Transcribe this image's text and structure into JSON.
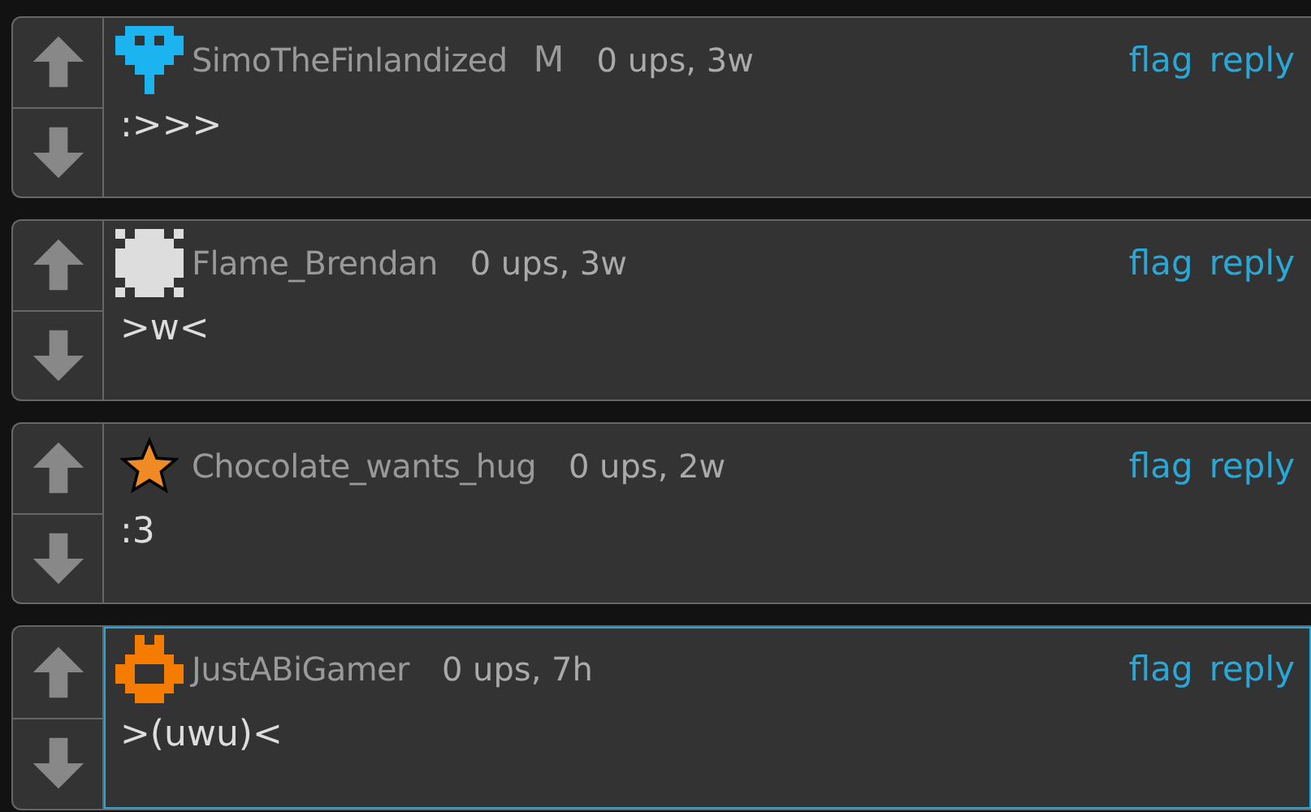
{
  "comments": [
    {
      "avatar": {
        "kind": "pixel-face"
      },
      "username": "SimoTheFinlandized",
      "badge": "M",
      "meta": "0 ups, 3w",
      "text": ":>>>",
      "highlighted": false,
      "actions": [
        "flag",
        "reply"
      ]
    },
    {
      "avatar": {
        "kind": "pixel-checker"
      },
      "username": "Flame_Brendan",
      "meta": "0 ups, 3w",
      "text": ">w<",
      "highlighted": false,
      "actions": [
        "flag",
        "reply"
      ]
    },
    {
      "avatar": {
        "kind": "star"
      },
      "username": "Chocolate_wants_hug",
      "meta": "0 ups, 2w",
      "text": ":3",
      "highlighted": false,
      "actions": [
        "flag",
        "reply"
      ]
    },
    {
      "avatar": {
        "kind": "pixel-cup"
      },
      "username": "JustABiGamer",
      "meta": "0 ups, 7h",
      "text": ">(uwu)<",
      "highlighted": true,
      "actions": [
        "flag",
        "reply"
      ]
    }
  ]
}
